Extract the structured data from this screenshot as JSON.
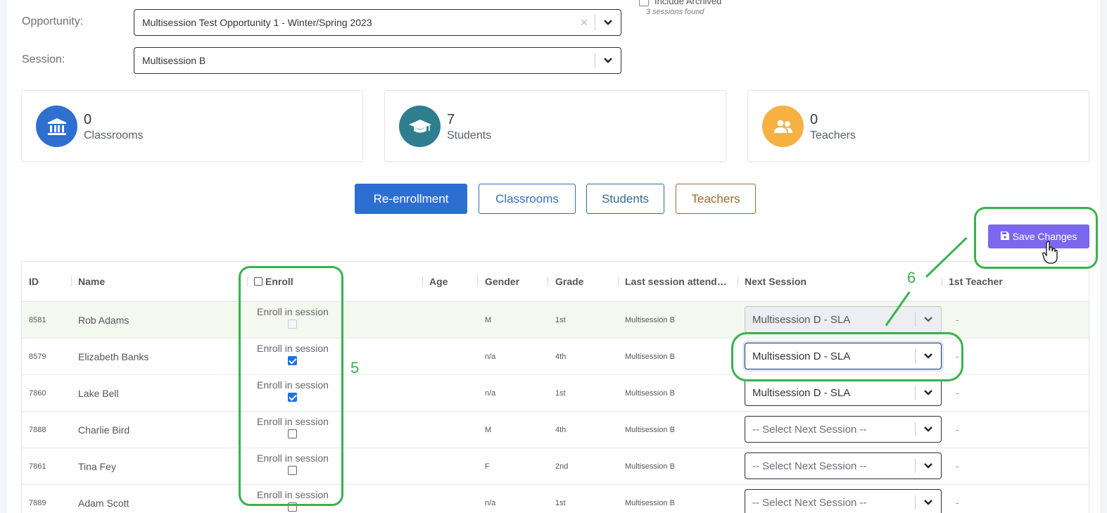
{
  "filters": {
    "opportunity_label": "Opportunity:",
    "opportunity_value": "Multisession Test Opportunity 1 - Winter/Spring 2023",
    "session_label": "Session:",
    "session_value": "Multisession B",
    "include_archived_label": "Include Archived",
    "sessions_found": "3 sessions found"
  },
  "stats": [
    {
      "value": "0",
      "label": "Classrooms",
      "icon": "bank-icon",
      "color": "#2f6fd0"
    },
    {
      "value": "7",
      "label": "Students",
      "icon": "graduation-cap-icon",
      "color": "#2f7e8f"
    },
    {
      "value": "0",
      "label": "Teachers",
      "icon": "users-icon",
      "color": "#f6b142"
    }
  ],
  "tabs": [
    {
      "label": "Re-enrollment",
      "active": true
    },
    {
      "label": "Classrooms"
    },
    {
      "label": "Students"
    },
    {
      "label": "Teachers"
    }
  ],
  "toolbar": {
    "save_label": "Save Changes"
  },
  "table": {
    "columns": [
      "ID",
      "Name",
      "Enroll",
      "Age",
      "Gender",
      "Grade",
      "Last session attend…",
      "Next Session",
      "1st Teacher"
    ],
    "enroll_cell_label": "Enroll in session",
    "rows": [
      {
        "id": "8581",
        "name": "Rob Adams",
        "age": "",
        "gender": "M",
        "grade": "1st",
        "last": "Multisession B",
        "enrolled": false,
        "disabled": true,
        "next": "Multisession D - SLA",
        "teacher": "-"
      },
      {
        "id": "8579",
        "name": "Elizabeth Banks",
        "age": "",
        "gender": "n/a",
        "grade": "4th",
        "last": "Multisession B",
        "enrolled": true,
        "disabled": false,
        "next": "Multisession D - SLA",
        "teacher": "-"
      },
      {
        "id": "7860",
        "name": "Lake Bell",
        "age": "",
        "gender": "n/a",
        "grade": "1st",
        "last": "Multisession B",
        "enrolled": true,
        "disabled": false,
        "next": "Multisession D - SLA",
        "teacher": "-"
      },
      {
        "id": "7888",
        "name": "Charlie Bird",
        "age": "",
        "gender": "M",
        "grade": "4th",
        "last": "Multisession B",
        "enrolled": false,
        "disabled": false,
        "next": "-- Select Next Session --",
        "teacher": "-"
      },
      {
        "id": "7861",
        "name": "Tina Fey",
        "age": "",
        "gender": "F",
        "grade": "2nd",
        "last": "Multisession B",
        "enrolled": false,
        "disabled": false,
        "next": "-- Select Next Session --",
        "teacher": "-"
      },
      {
        "id": "7889",
        "name": "Adam Scott",
        "age": "",
        "gender": "n/a",
        "grade": "1st",
        "last": "Multisession B",
        "enrolled": false,
        "disabled": false,
        "next": "-- Select Next Session --",
        "teacher": "-"
      }
    ]
  },
  "annotations": {
    "enroll_marker": "5",
    "save_marker": "6",
    "color": "#37b24d"
  }
}
